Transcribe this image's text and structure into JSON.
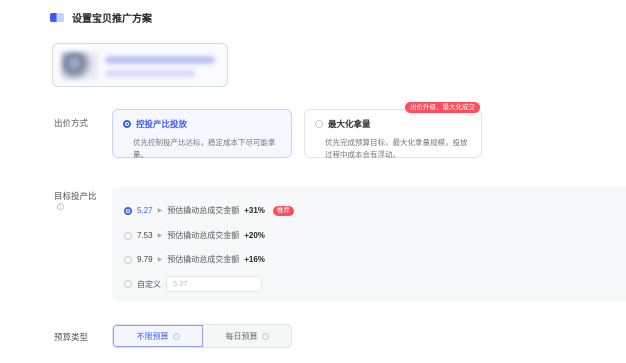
{
  "header": {
    "icon": "promo-plan-icon",
    "title": "设置宝贝推广方案"
  },
  "product": {
    "icon": "product-thumbnail"
  },
  "bid_method": {
    "label": "出价方式",
    "options": [
      {
        "title": "控投产比投放",
        "desc": "优先控制投产比达标，稳定成本下尽可能拿量。",
        "selected": true
      },
      {
        "title": "最大化拿量",
        "desc": "优先完成预算目标，最大化拿量规模，投放过程中成本会有浮动。",
        "selected": false,
        "badge": "出价升级，最大化成交"
      }
    ]
  },
  "target_roi": {
    "label": "目标投产比",
    "options": [
      {
        "value": "5.27",
        "text": "预估撬动总成交金额",
        "pct": "+31%",
        "badge": "推荐",
        "selected": true
      },
      {
        "value": "7.53",
        "text": "预估撬动总成交金额",
        "pct": "+20%",
        "selected": false
      },
      {
        "value": "9.79",
        "text": "预估撬动总成交金额",
        "pct": "+16%",
        "selected": false
      }
    ],
    "custom_label": "自定义",
    "custom_placeholder": "5.27"
  },
  "budget": {
    "label": "预算类型",
    "options": [
      {
        "label": "不限预算",
        "selected": true
      },
      {
        "label": "每日预算",
        "selected": false
      }
    ]
  },
  "colors": {
    "accent": "#3b5bff",
    "badge": "#ff4d5a",
    "panel": "#f7f8fa"
  }
}
